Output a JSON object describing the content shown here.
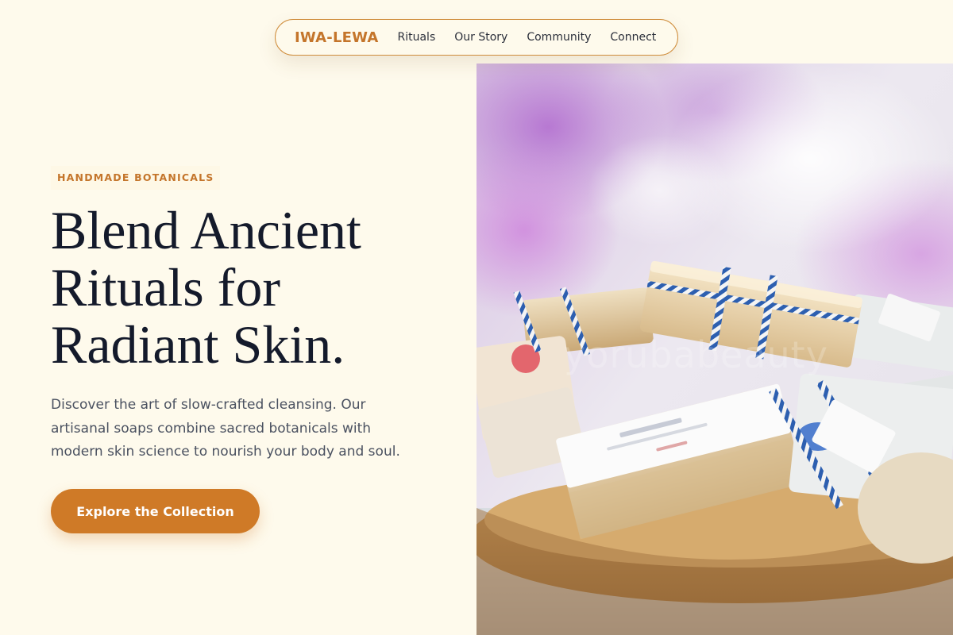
{
  "nav": {
    "brand": "IWA-LEWA",
    "links": [
      "Rituals",
      "Our Story",
      "Community",
      "Connect"
    ]
  },
  "hero": {
    "eyebrow": "HANDMADE BOTANICALS",
    "headline_lines": [
      "Blend Ancient",
      "Rituals for",
      "Radiant Skin."
    ],
    "lede_lines": [
      "Discover the art of slow-crafted cleansing. Our",
      "artisanal soaps combine sacred botanicals with",
      "modern skin science to nourish your body and soul."
    ],
    "cta_label": "Explore the Collection",
    "image": {
      "subject": "handmade soap bars tied with blue and white twine in a wooden bowl",
      "watermark": "yorubabeauty"
    }
  },
  "colors": {
    "background": "#fefaec",
    "accent": "#cf7a27",
    "brand_text": "#c4752b",
    "headline": "#141a2b",
    "body_text": "#4a5160"
  }
}
